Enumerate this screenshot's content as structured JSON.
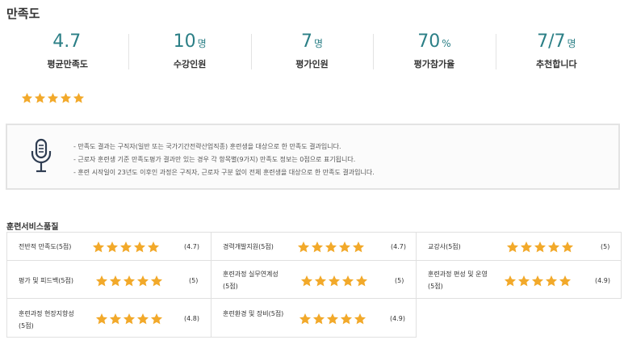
{
  "page_title": "만족도",
  "stats": [
    {
      "value": "4.7",
      "unit": "",
      "label": "평균만족도"
    },
    {
      "value": "10",
      "unit": "명",
      "label": "수강인원"
    },
    {
      "value": "7",
      "unit": "명",
      "label": "평가인원"
    },
    {
      "value": "70",
      "unit": "%",
      "label": "평가참가율"
    },
    {
      "value": "7/7",
      "unit": "명",
      "label": "추천합니다"
    }
  ],
  "overall_stars": 5,
  "notice": {
    "icon": "microphone-icon",
    "lines": [
      "- 만족도 결과는 구직자(일반 또는 국가기간전략산업직종) 훈련생을 대상으로 한 만족도 결과입니다.",
      "- 근로자 훈련생 기준 만족도평가 결과만 있는 경우 각 항목별(9가지) 만족도 정보는 0점으로 표기됩니다.",
      "- 훈련 시작일이 23년도 이후인 과정은 구직자, 근로자 구분 없이 전체 훈련생을 대상으로 한 만족도 결과입니다."
    ]
  },
  "service_quality": {
    "title": "훈련서비스품질",
    "items": [
      {
        "label": "전반적 만족도(5점)",
        "score": "4.7",
        "stars": 5
      },
      {
        "label": "경력개발지원(5점)",
        "score": "4.7",
        "stars": 5
      },
      {
        "label": "교강사(5점)",
        "score": "5",
        "stars": 5
      },
      {
        "label": "평가 및 피드백(5점)",
        "score": "5",
        "stars": 5
      },
      {
        "label": "훈련과정 실무연계성(5점)",
        "score": "5",
        "stars": 5
      },
      {
        "label": "훈련과정 편성 및 운영(5점)",
        "score": "4.9",
        "stars": 5
      },
      {
        "label": "훈련과정 현장지향성(5점)",
        "score": "4.8",
        "stars": 5
      },
      {
        "label": "훈련환경 및 장비(5점)",
        "score": "4.9",
        "stars": 5
      }
    ]
  },
  "colors": {
    "accent": "#2b7f86",
    "star": "#f2a92a",
    "border": "#e0e0e0"
  }
}
